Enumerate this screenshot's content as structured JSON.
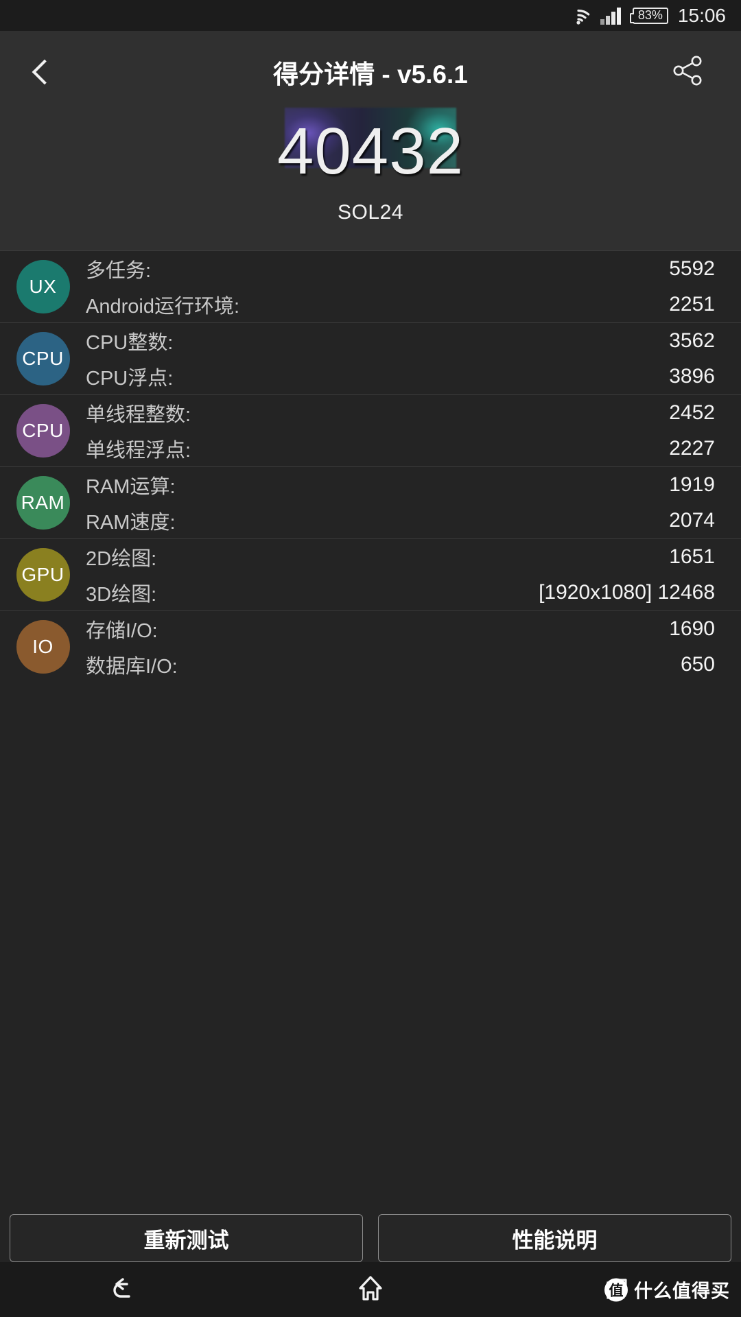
{
  "statusbar": {
    "wifi_icon": "wifi-icon",
    "signal_icon": "cellular-signal-icon",
    "battery_percent": "83%",
    "time": "15:06"
  },
  "titlebar": {
    "back_icon": "back-chevron-icon",
    "title": "得分详情 - v5.6.1",
    "share_icon": "share-icon"
  },
  "hero": {
    "total_score": "40432",
    "device_model": "SOL24"
  },
  "colors": {
    "ux": "#1b7a6e",
    "cpu_multi": "#2c6384",
    "cpu_single": "#7a5086",
    "ram": "#3a8a5a",
    "gpu": "#8a8020",
    "io": "#8a5a2e",
    "page_bg": "#242424",
    "header_bg": "#303030"
  },
  "groups": [
    {
      "badge": "UX",
      "color_key": "ux",
      "rows": [
        {
          "label": "多任务:",
          "value": "5592"
        },
        {
          "label": "Android运行环境:",
          "value": "2251"
        }
      ]
    },
    {
      "badge": "CPU",
      "color_key": "cpu_multi",
      "rows": [
        {
          "label": "CPU整数:",
          "value": "3562"
        },
        {
          "label": "CPU浮点:",
          "value": "3896"
        }
      ]
    },
    {
      "badge": "CPU",
      "color_key": "cpu_single",
      "rows": [
        {
          "label": "单线程整数:",
          "value": "2452"
        },
        {
          "label": "单线程浮点:",
          "value": "2227"
        }
      ]
    },
    {
      "badge": "RAM",
      "color_key": "ram",
      "rows": [
        {
          "label": "RAM运算:",
          "value": "1919"
        },
        {
          "label": "RAM速度:",
          "value": "2074"
        }
      ]
    },
    {
      "badge": "GPU",
      "color_key": "gpu",
      "rows": [
        {
          "label": "2D绘图:",
          "value": "1651"
        },
        {
          "label": "3D绘图:",
          "value": "[1920x1080] 12468"
        }
      ]
    },
    {
      "badge": "IO",
      "color_key": "io",
      "rows": [
        {
          "label": "存储I/O:",
          "value": "1690"
        },
        {
          "label": "数据库I/O:",
          "value": "650"
        }
      ]
    }
  ],
  "footer": {
    "retest_label": "重新测试",
    "performance_label": "性能说明"
  },
  "navbar": {
    "back_icon": "nav-back-icon",
    "home_icon": "nav-home-icon",
    "recents_icon": "nav-recents-icon",
    "watermark_logo": "值",
    "watermark_text": "什么值得买"
  }
}
